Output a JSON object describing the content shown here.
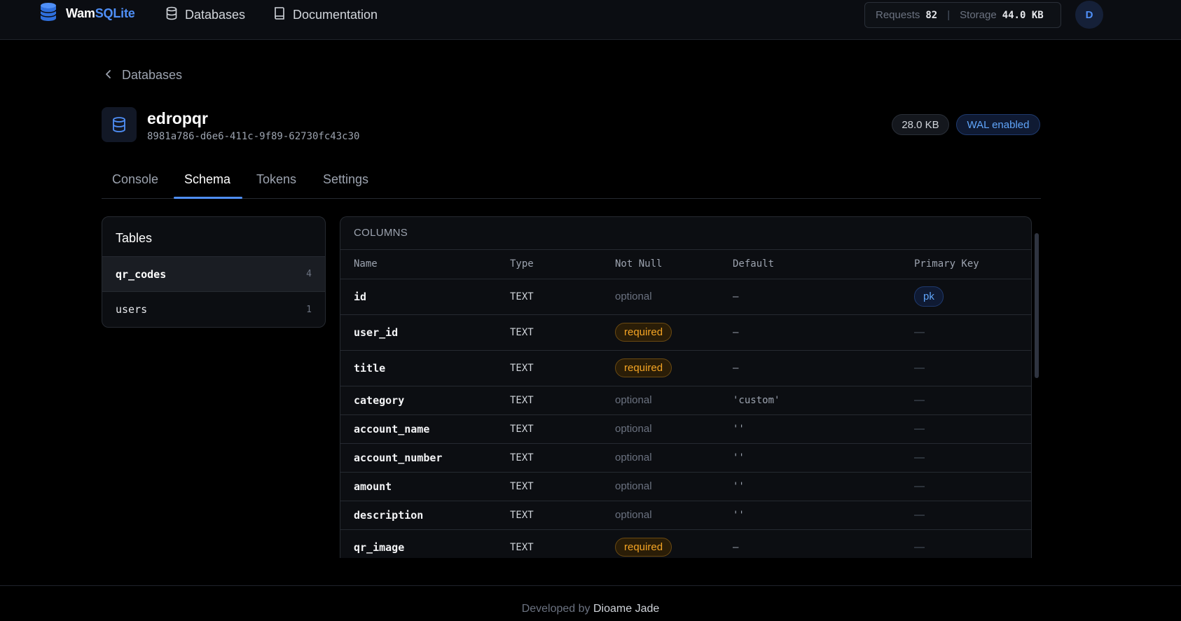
{
  "header": {
    "logo_prefix": "Wam",
    "logo_suffix": "SQLite",
    "nav": [
      {
        "label": "Databases",
        "icon": "database-icon"
      },
      {
        "label": "Documentation",
        "icon": "book-icon"
      }
    ],
    "stats": {
      "requests_label": "Requests",
      "requests_value": "82",
      "storage_label": "Storage",
      "storage_value": "44.0 KB"
    },
    "avatar_initial": "D"
  },
  "breadcrumb": {
    "label": "Databases"
  },
  "database": {
    "name": "edropqr",
    "uuid": "8981a786-d6e6-411c-9f89-62730fc43c30",
    "size_badge": "28.0 KB",
    "wal_badge": "WAL enabled"
  },
  "tabs": [
    {
      "label": "Console",
      "active": false
    },
    {
      "label": "Schema",
      "active": true
    },
    {
      "label": "Tokens",
      "active": false
    },
    {
      "label": "Settings",
      "active": false
    }
  ],
  "tables_panel": {
    "title": "Tables",
    "items": [
      {
        "name": "qr_codes",
        "count": "4",
        "active": true
      },
      {
        "name": "users",
        "count": "1",
        "active": false
      }
    ]
  },
  "columns_panel": {
    "title": "COLUMNS",
    "headers": [
      "Name",
      "Type",
      "Not Null",
      "Default",
      "Primary Key"
    ],
    "rows": [
      {
        "name": "id",
        "type": "TEXT",
        "not_null": "optional",
        "default": "—",
        "pk": "pk"
      },
      {
        "name": "user_id",
        "type": "TEXT",
        "not_null": "required",
        "default": "—",
        "pk": "—"
      },
      {
        "name": "title",
        "type": "TEXT",
        "not_null": "required",
        "default": "—",
        "pk": "—"
      },
      {
        "name": "category",
        "type": "TEXT",
        "not_null": "optional",
        "default": "'custom'",
        "pk": "—"
      },
      {
        "name": "account_name",
        "type": "TEXT",
        "not_null": "optional",
        "default": "''",
        "pk": "—"
      },
      {
        "name": "account_number",
        "type": "TEXT",
        "not_null": "optional",
        "default": "''",
        "pk": "—"
      },
      {
        "name": "amount",
        "type": "TEXT",
        "not_null": "optional",
        "default": "''",
        "pk": "—"
      },
      {
        "name": "description",
        "type": "TEXT",
        "not_null": "optional",
        "default": "''",
        "pk": "—"
      },
      {
        "name": "qr_image",
        "type": "TEXT",
        "not_null": "required",
        "default": "—",
        "pk": "—"
      }
    ]
  },
  "footer": {
    "prefix": "Developed by",
    "author": "Dioame Jade"
  },
  "colors": {
    "accent": "#4f8ff7",
    "required": "#f5a524",
    "background": "#000000"
  }
}
